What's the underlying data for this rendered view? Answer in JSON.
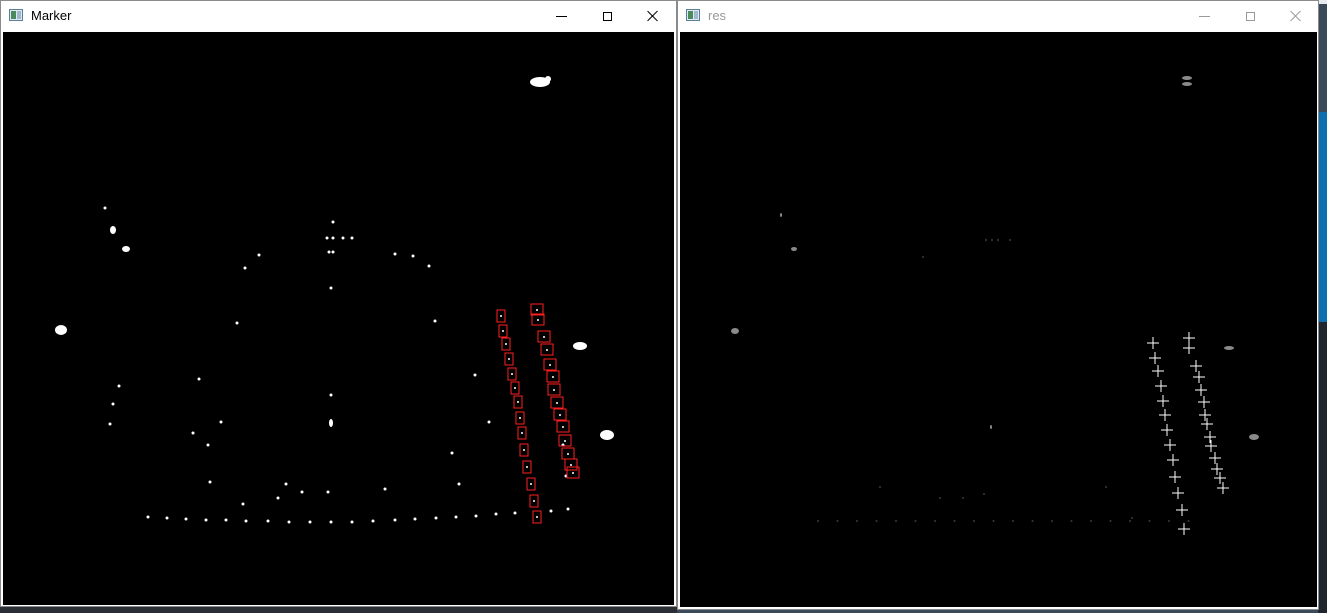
{
  "windows": [
    {
      "title": "Marker",
      "active": true,
      "controls": {
        "minimize_icon": "minimize-icon",
        "maximize_icon": "maximize-icon",
        "close_icon": "close-icon"
      }
    },
    {
      "title": "res",
      "active": false,
      "controls": {
        "minimize_icon": "minimize-icon",
        "maximize_icon": "maximize-icon",
        "close_icon": "close-icon"
      }
    }
  ],
  "colors": {
    "canvas_background": "#000000",
    "marker_box": "#ff2020",
    "blob": "#ffffff",
    "crosshair": "#ffffff",
    "res_dim_dot": "#3a3a3a"
  }
}
